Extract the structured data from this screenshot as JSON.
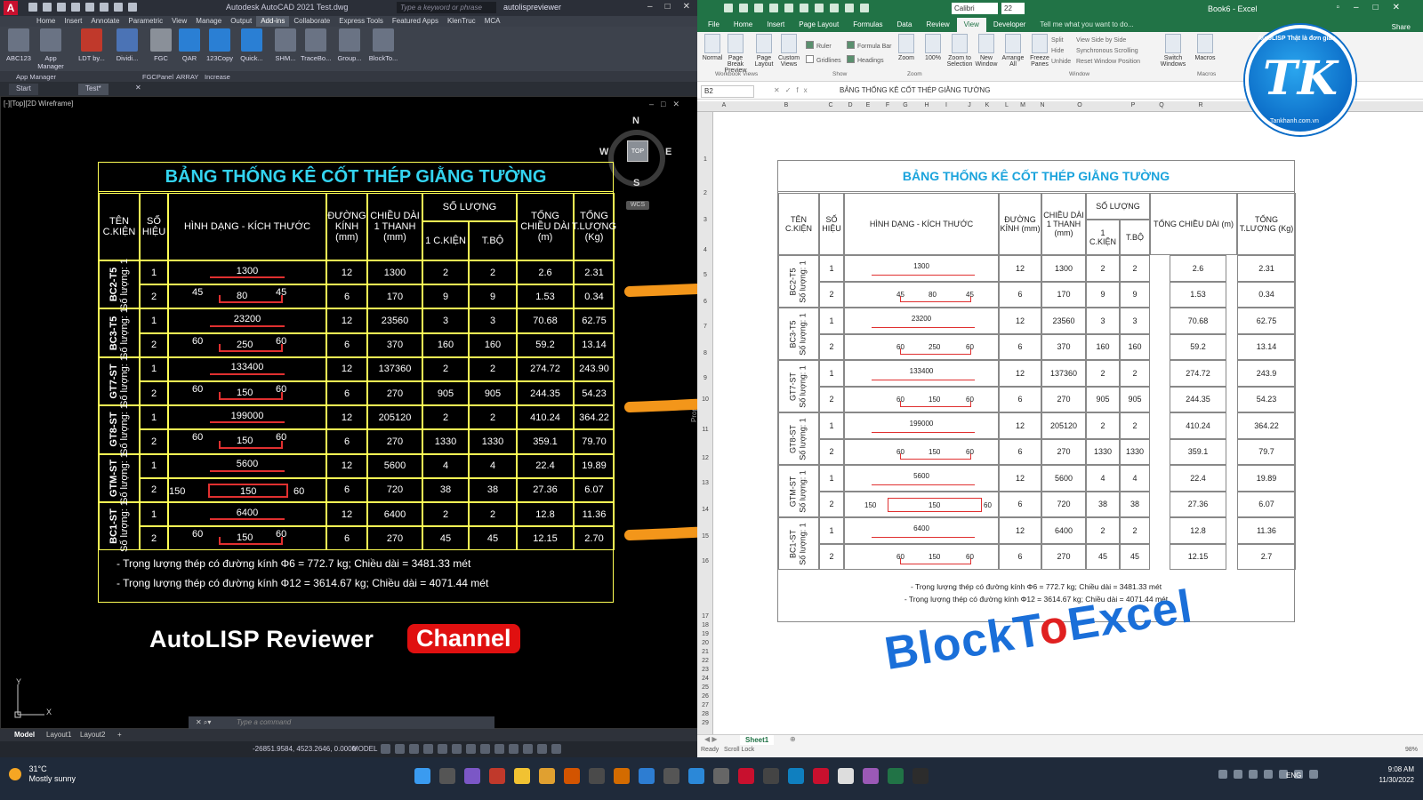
{
  "acad": {
    "title": "Autodesk AutoCAD 2021    Test.dwg",
    "search_placeholder": "Type a keyword or phrase",
    "user": "autolispreviewer",
    "menu_tabs": [
      "Home",
      "Insert",
      "Annotate",
      "Parametric",
      "View",
      "Manage",
      "Output",
      "Add-ins",
      "Collaborate",
      "Express Tools",
      "Featured Apps",
      "KlenTruc",
      "MCA"
    ],
    "active_tab": "Add-ins",
    "ribbon_buttons": [
      "ABC123",
      "App Manager",
      "LDT by...",
      "Dividi...",
      "FGC",
      "QAR",
      "123Copy",
      "Quick...",
      "SHM...",
      "TraceBo...",
      "Group...",
      "BlockTo..."
    ],
    "panel_names": [
      "App Manager",
      "FGCPanel",
      "ARRAY",
      "Increase"
    ],
    "doc_tabs": [
      "Start",
      "Test*"
    ],
    "viewport_label": "[-][Top][2D Wireframe]",
    "viewcube": {
      "n": "N",
      "s": "S",
      "e": "E",
      "w": "W",
      "top": "TOP",
      "wcs": "WCS"
    },
    "command_placeholder": "Type a command",
    "layouts": [
      "Model",
      "Layout1",
      "Layout2"
    ],
    "coords": "-26851.9584, 4523.2646, 0.0000",
    "model_label": "MODEL",
    "ucs_x": "X",
    "ucs_y": "Y",
    "side_label": "Prop"
  },
  "table": {
    "title": "BẢNG THỐNG KÊ CỐT THÉP GIẰNG TƯỜNG",
    "headers": {
      "ten": "TÊN C.KIỆN",
      "so_hieu": "SỐ HIỆU",
      "hinh_dang": "HÌNH DẠNG - KÍCH THƯỚC",
      "duong_kinh": "ĐƯỜNG KÍNH (mm)",
      "chieu_dai": "CHIỀU DÀI 1 THANH (mm)",
      "so_luong": "SỐ LƯỢNG",
      "ckien": "1 C.KIỆN",
      "tbo": "T.BỘ",
      "tong_cd": "TỔNG CHIỀU DÀI (m)",
      "tong_tl": "TỔNG T.LƯỢNG (Kg)"
    },
    "groups": [
      {
        "name": "BC2-T5",
        "qty": "Số lượng: 1",
        "rows": [
          {
            "no": "1",
            "shape": {
              "type": "line",
              "mid": "1300"
            },
            "dk": "12",
            "cd": "1300",
            "ck": "2",
            "tb": "2",
            "tcd": "2.6",
            "ttl": "2.31",
            "ttl_x": "2.31"
          },
          {
            "no": "2",
            "shape": {
              "type": "stirrup",
              "l": "45",
              "mid": "80",
              "r": "45"
            },
            "dk": "6",
            "cd": "170",
            "ck": "9",
            "tb": "9",
            "tcd": "1.53",
            "ttl": "0.34",
            "ttl_x": "0.34"
          }
        ]
      },
      {
        "name": "BC3-T5",
        "qty": "Số lượng: 1",
        "rows": [
          {
            "no": "1",
            "shape": {
              "type": "line",
              "mid": "23200"
            },
            "dk": "12",
            "cd": "23560",
            "ck": "3",
            "tb": "3",
            "tcd": "70.68",
            "ttl": "62.75",
            "ttl_x": "62.75"
          },
          {
            "no": "2",
            "shape": {
              "type": "stirrup",
              "l": "60",
              "mid": "250",
              "r": "60"
            },
            "dk": "6",
            "cd": "370",
            "ck": "160",
            "tb": "160",
            "tcd": "59.2",
            "ttl": "13.14",
            "ttl_x": "13.14"
          }
        ]
      },
      {
        "name": "GT7-ST",
        "qty": "Số lượng: 1",
        "rows": [
          {
            "no": "1",
            "shape": {
              "type": "line",
              "mid": "133400"
            },
            "dk": "12",
            "cd": "137360",
            "ck": "2",
            "tb": "2",
            "tcd": "274.72",
            "ttl": "243.90",
            "ttl_x": "243.9"
          },
          {
            "no": "2",
            "shape": {
              "type": "stirrup",
              "l": "60",
              "mid": "150",
              "r": "60"
            },
            "dk": "6",
            "cd": "270",
            "ck": "905",
            "tb": "905",
            "tcd": "244.35",
            "ttl": "54.23",
            "ttl_x": "54.23"
          }
        ]
      },
      {
        "name": "GT8-ST",
        "qty": "Số lượng: 1",
        "rows": [
          {
            "no": "1",
            "shape": {
              "type": "line",
              "mid": "199000"
            },
            "dk": "12",
            "cd": "205120",
            "ck": "2",
            "tb": "2",
            "tcd": "410.24",
            "ttl": "364.22",
            "ttl_x": "364.22"
          },
          {
            "no": "2",
            "shape": {
              "type": "stirrup",
              "l": "60",
              "mid": "150",
              "r": "60"
            },
            "dk": "6",
            "cd": "270",
            "ck": "1330",
            "tb": "1330",
            "tcd": "359.1",
            "ttl": "79.70",
            "ttl_x": "79.7"
          }
        ]
      },
      {
        "name": "GTM-ST",
        "qty": "Số lượng: 1",
        "rows": [
          {
            "no": "1",
            "shape": {
              "type": "line",
              "mid": "5600"
            },
            "dk": "12",
            "cd": "5600",
            "ck": "4",
            "tb": "4",
            "tcd": "22.4",
            "ttl": "19.89",
            "ttl_x": "19.89"
          },
          {
            "no": "2",
            "shape": {
              "type": "box",
              "l": "150",
              "mid": "150",
              "r": "60"
            },
            "dk": "6",
            "cd": "720",
            "ck": "38",
            "tb": "38",
            "tcd": "27.36",
            "ttl": "6.07",
            "ttl_x": "6.07"
          }
        ]
      },
      {
        "name": "BC1-ST",
        "qty": "Số lượng: 1",
        "rows": [
          {
            "no": "1",
            "shape": {
              "type": "line",
              "mid": "6400"
            },
            "dk": "12",
            "cd": "6400",
            "ck": "2",
            "tb": "2",
            "tcd": "12.8",
            "ttl": "11.36",
            "ttl_x": "11.36"
          },
          {
            "no": "2",
            "shape": {
              "type": "stirrup",
              "l": "60",
              "mid": "150",
              "r": "60"
            },
            "dk": "6",
            "cd": "270",
            "ck": "45",
            "tb": "45",
            "tcd": "12.15",
            "ttl": "2.70",
            "ttl_x": "2.7"
          }
        ]
      }
    ],
    "notes": [
      "- Trọng lượng thép có đường kính Φ6  =  772.7 kg; Chiều dài = 3481.33 mét",
      "- Trọng lượng thép có đường kính Φ12  =  3614.67 kg; Chiều dài = 4071.44 mét"
    ]
  },
  "overlay": {
    "channel_text": "AutoLISP Reviewer",
    "channel_badge": "Channel",
    "brand_a": "BlockT",
    "brand_o": "o",
    "brand_b": "Excel",
    "logo_letters": "TK",
    "logo_ring_top": "AutoLISP Thật là đơn giản",
    "logo_ring_bottom": "Tankhanh.com.vn",
    "colors": {
      "arrow": "#f3961a",
      "brand": "#1a6fd9",
      "badge": "#e01010",
      "cad_border": "#ffff55",
      "cad_title": "#33d3f0",
      "excel_title": "#1aa3dc"
    }
  },
  "excel": {
    "title": "Book6 - Excel",
    "font_name": "Calibri",
    "font_size": "22",
    "tabs": [
      "File",
      "Home",
      "Insert",
      "Page Layout",
      "Formulas",
      "Data",
      "Review",
      "View",
      "Developer"
    ],
    "active_tab": "View",
    "tell_me": "Tell me what you want to do...",
    "share": "Share",
    "ribbon": {
      "views": [
        "Normal",
        "Page Break Preview",
        "Page Layout",
        "Custom Views"
      ],
      "show": [
        "Ruler",
        "Formula Bar",
        "Gridlines",
        "Headings"
      ],
      "zoom": [
        "Zoom",
        "100%",
        "Zoom to Selection"
      ],
      "window": [
        "New Window",
        "Arrange All",
        "Freeze Panes"
      ],
      "window_small": [
        "Split",
        "Hide",
        "Unhide",
        "View Side by Side",
        "Synchronous Scrolling",
        "Reset Window Position"
      ],
      "switch": "Switch Windows",
      "macros": "Macros",
      "groups": [
        "Workbook Views",
        "Show",
        "Zoom",
        "Window",
        "Macros"
      ]
    },
    "name_box": "B2",
    "formula_value": "BẢNG THỐNG KÊ CỐT THÉP GIẰNG TƯỜNG",
    "columns": [
      "A",
      "B",
      "C",
      "D",
      "E",
      "F",
      "G",
      "H",
      "I",
      "J",
      "K",
      "L",
      "M",
      "N",
      "O",
      "P",
      "Q",
      "R",
      "S"
    ],
    "rows": [
      "1",
      "2",
      "3",
      "4",
      "5",
      "6",
      "7",
      "8",
      "9",
      "10",
      "11",
      "12",
      "13",
      "14",
      "15",
      "16",
      "17",
      "18",
      "19",
      "20",
      "21",
      "22",
      "23",
      "24",
      "25",
      "26",
      "27",
      "28",
      "29"
    ],
    "sheet": "Sheet1",
    "status_ready": "Ready",
    "status_scroll": "Scroll Lock",
    "zoom": "98%"
  },
  "taskbar": {
    "temp": "31°C",
    "weather": "Mostly sunny",
    "lang": "ENG",
    "time": "9:08 AM",
    "date": "11/30/2022"
  }
}
